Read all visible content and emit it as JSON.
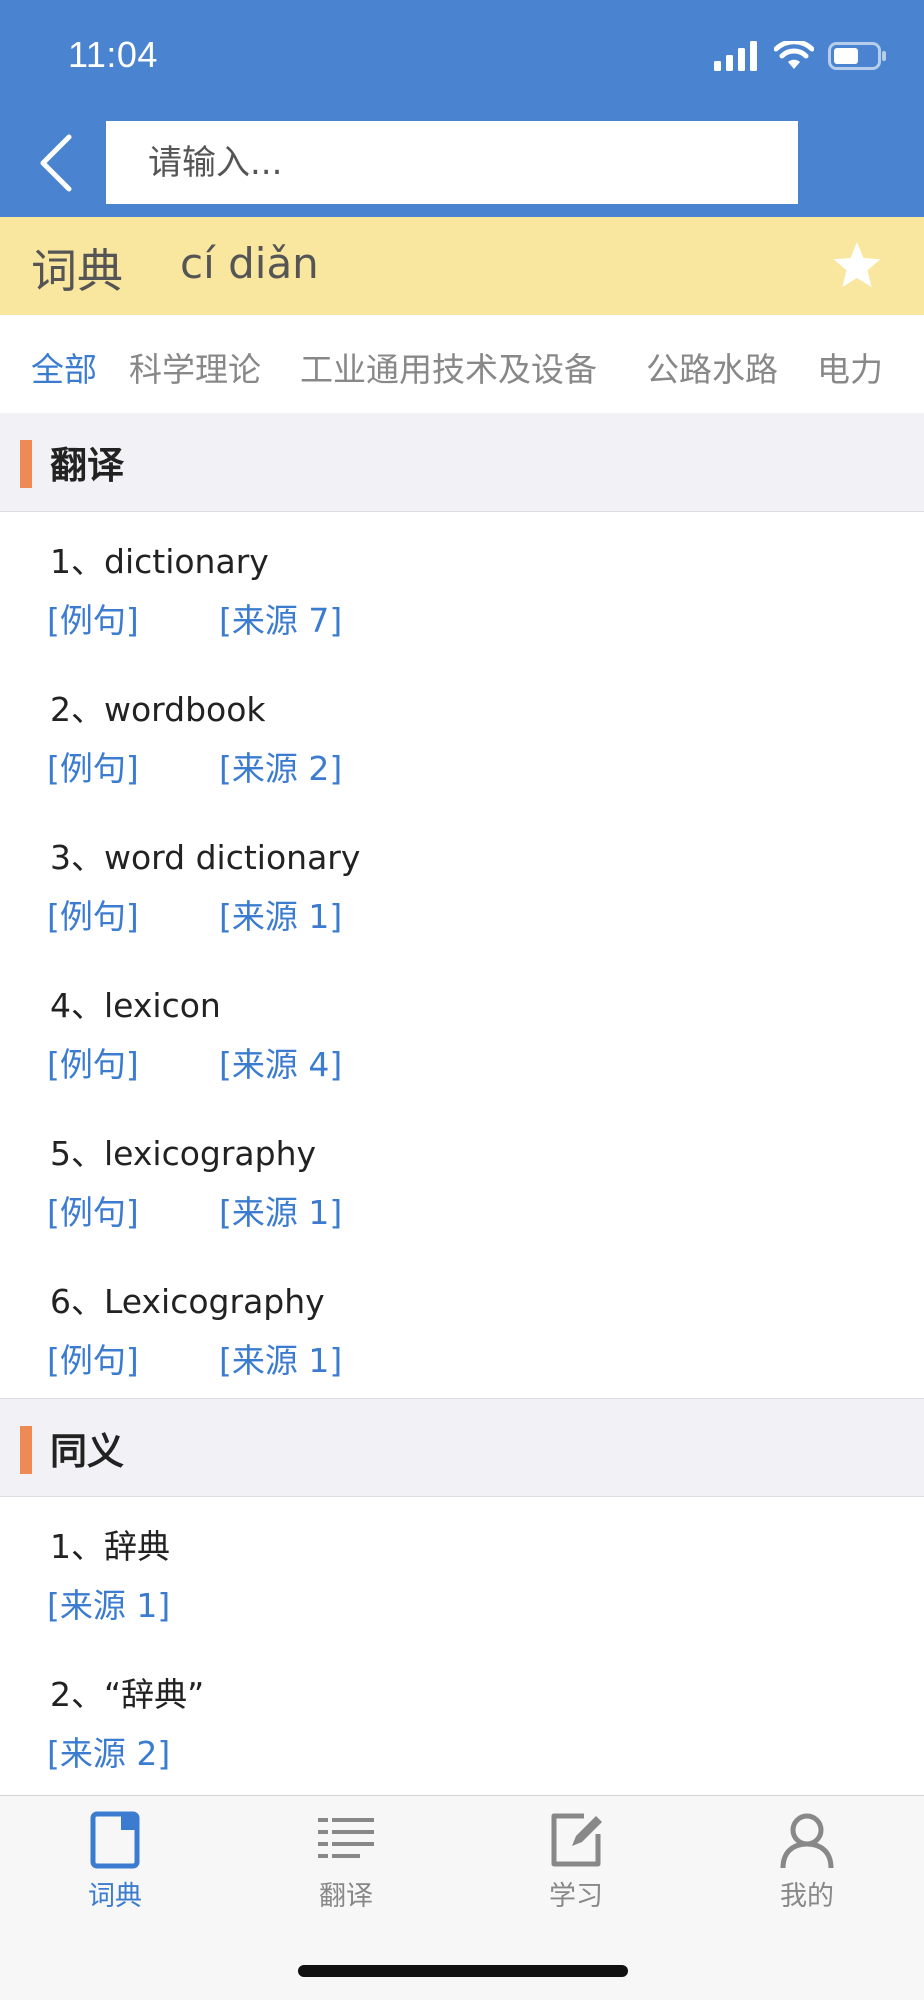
{
  "status_bar": {
    "time": "11:04"
  },
  "search": {
    "placeholder": "请输入..."
  },
  "word": {
    "hanzi": "词典",
    "pinyin": "cí diǎn"
  },
  "category_tabs": [
    {
      "label": "全部",
      "active": true
    },
    {
      "label": "科学理论",
      "active": false
    },
    {
      "label": "工业通用技术及设备",
      "active": false
    },
    {
      "label": "公路水路",
      "active": false
    },
    {
      "label": "电力",
      "active": false
    }
  ],
  "translation_section": {
    "title": "翻译",
    "entries": [
      {
        "text": "1、dictionary",
        "example": "[例句]",
        "source": "[来源 7]"
      },
      {
        "text": "2、wordbook",
        "example": "[例句]",
        "source": "[来源 2]"
      },
      {
        "text": "3、word dictionary",
        "example": "[例句]",
        "source": "[来源 1]"
      },
      {
        "text": "4、lexicon",
        "example": "[例句]",
        "source": "[来源 4]"
      },
      {
        "text": "5、lexicography",
        "example": "[例句]",
        "source": "[来源 1]"
      },
      {
        "text": "6、Lexicography",
        "example": "[例句]",
        "source": "[来源 1]"
      }
    ]
  },
  "synonym_section": {
    "title": "同义",
    "entries": [
      {
        "text": "1、辞典",
        "source": "[来源 1]"
      },
      {
        "text": "2、“辞典”",
        "source": "[来源 2]"
      }
    ]
  },
  "tab_bar": {
    "items": [
      {
        "label": "词典",
        "icon": "book-icon",
        "active": true
      },
      {
        "label": "翻译",
        "icon": "list-icon",
        "active": false
      },
      {
        "label": "学习",
        "icon": "edit-icon",
        "active": false
      },
      {
        "label": "我的",
        "icon": "person-icon",
        "active": false
      }
    ]
  },
  "colors": {
    "header_blue": "#4a84d0",
    "word_bar_yellow": "#f9e69f",
    "accent_blue": "#3b7cd0",
    "section_marker_orange": "#ef8a55"
  }
}
